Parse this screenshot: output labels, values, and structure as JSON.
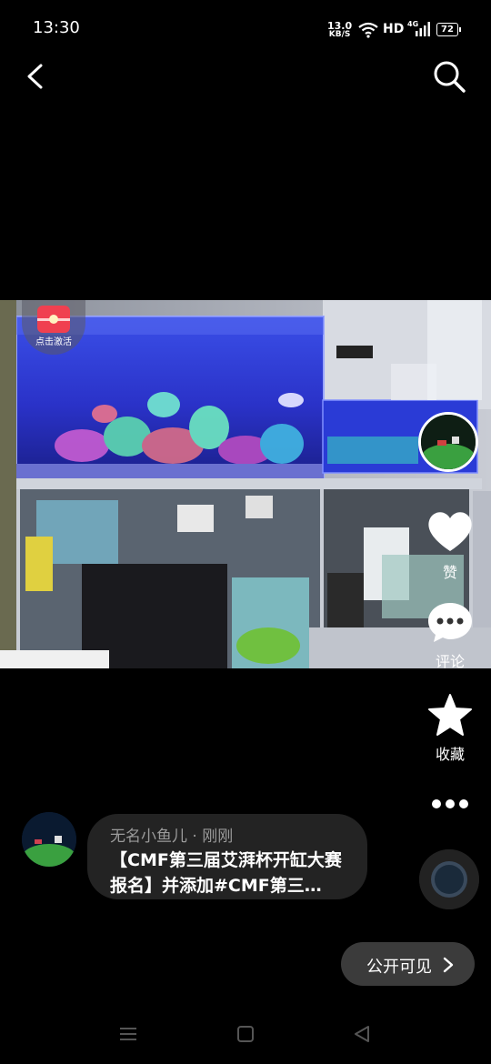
{
  "status_bar": {
    "time": "13:30",
    "speed_value": "13.0",
    "speed_unit": "KB/S",
    "network_label": "HD",
    "network_type": "4G",
    "battery": "72"
  },
  "nav": {
    "back_icon": "chevron-left-icon",
    "search_icon": "search-icon"
  },
  "post": {
    "activate_label": "点击激活",
    "author_line": "无名小鱼儿 · 刚刚",
    "caption": "【CMF第三届艾湃杯开缸大赛报名】并添加#CMF第三…"
  },
  "actions": {
    "like_label": "赞",
    "comment_label": "评论",
    "favorite_label": "收藏"
  },
  "visibility": {
    "label": "公开可见"
  },
  "colors": {
    "background": "#000000",
    "bubble": "#232323",
    "aquarium_blue": "#2a3bd6"
  }
}
